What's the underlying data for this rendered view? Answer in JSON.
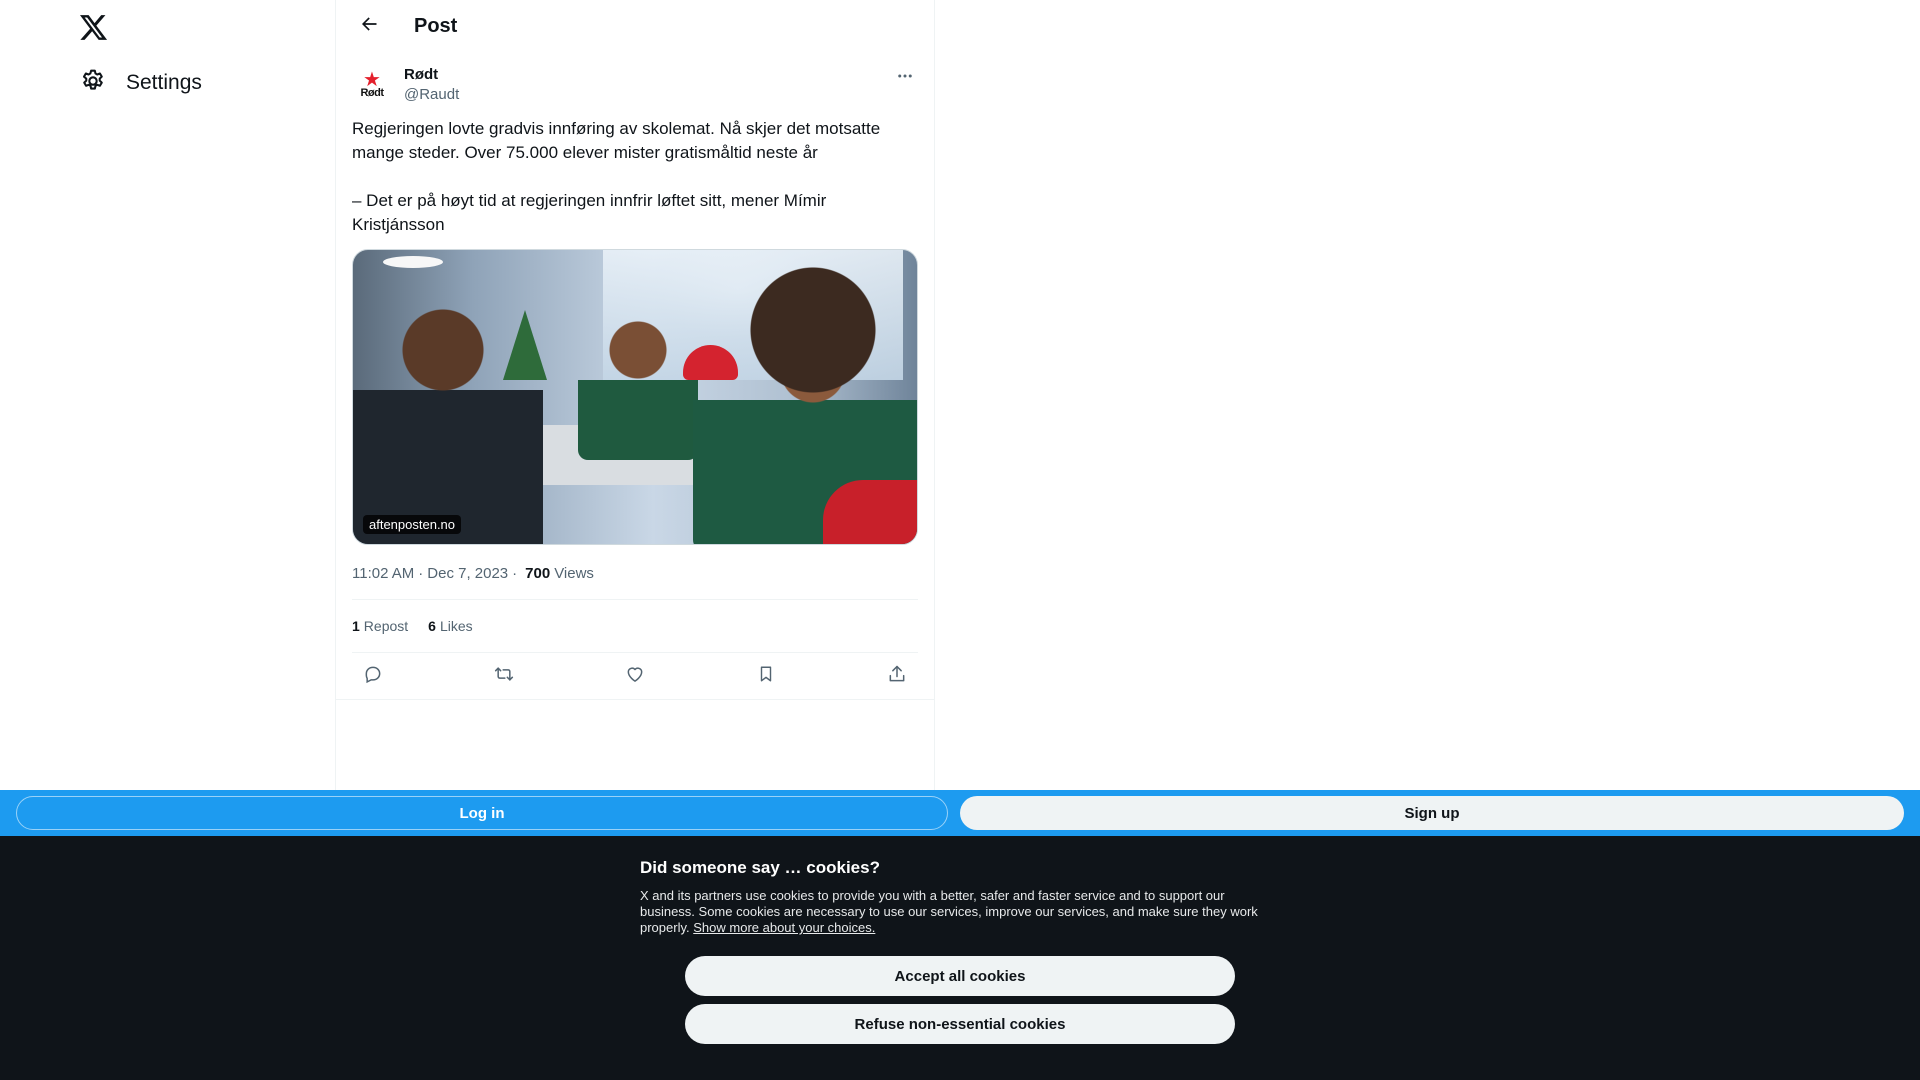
{
  "nav": {
    "logo_icon": "x-logo-icon",
    "settings_label": "Settings",
    "settings_icon": "gear-icon"
  },
  "header": {
    "back_icon": "arrow-left-icon",
    "title": "Post"
  },
  "post": {
    "author": {
      "name": "Rødt",
      "handle": "@Raudt",
      "avatar_text": "Rødt",
      "avatar_color": "#e4202c"
    },
    "text": "Regjeringen lovte gradvis innføring av skolemat. Nå skjer det motsatte mange steder. Over 75.000 elever mister gratismåltid neste år\n\n– Det er på høyt tid at regjeringen innfrir løftet sitt, mener Mímir Kristjánsson",
    "media": {
      "source": "aftenposten.no"
    },
    "time": "11:02 AM",
    "date": "Dec 7, 2023",
    "views_count": "700",
    "views_label": "Views",
    "reposts_count": "1",
    "reposts_label": "Repost",
    "likes_count": "6",
    "likes_label": "Likes",
    "actions": [
      "reply-icon",
      "repost-icon",
      "like-icon",
      "bookmark-icon",
      "share-icon"
    ]
  },
  "login_bar": {
    "login_label": "Log in",
    "signup_label": "Sign up",
    "bar_color": "#1d9bf0"
  },
  "cookie_banner": {
    "title": "Did someone say … cookies?",
    "text": "X and its partners use cookies to provide you with a better, safer and faster service and to support our business. Some cookies are necessary to use our services, improve our services, and make sure they work properly.",
    "link": "Show more about your choices.",
    "accept_label": "Accept all cookies",
    "refuse_label": "Refuse non-essential cookies"
  }
}
